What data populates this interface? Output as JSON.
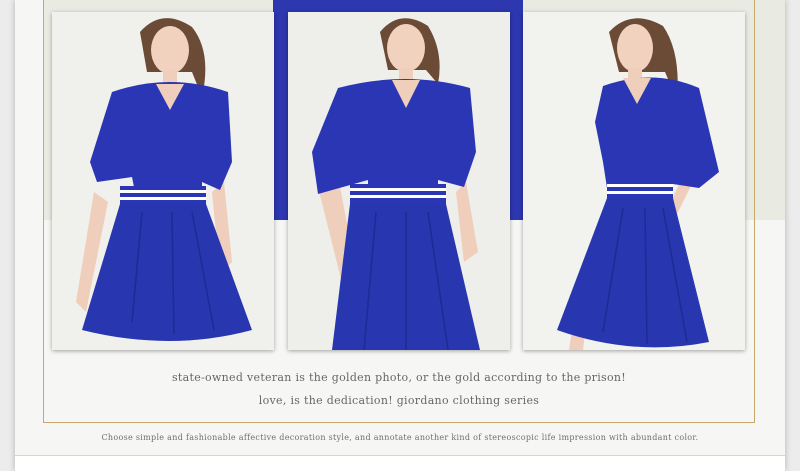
{
  "brand_colors": {
    "dress": "#2a36b3",
    "accent_gold": "#c9a96a"
  },
  "photos": [
    {
      "alt": "Model in blue V-neck dress, front view"
    },
    {
      "alt": "Model in blue V-neck dress, hands on waist"
    },
    {
      "alt": "Model in blue V-neck dress, side pose"
    }
  ],
  "captions": {
    "line1": "state-owned veteran is the golden photo, or the gold according to the prison!",
    "line2": "love, is the dedication! giordano clothing series",
    "tagline": "Choose simple and fashionable affective decoration style, and annotate another kind of stereoscopic life impression with abundant color."
  }
}
